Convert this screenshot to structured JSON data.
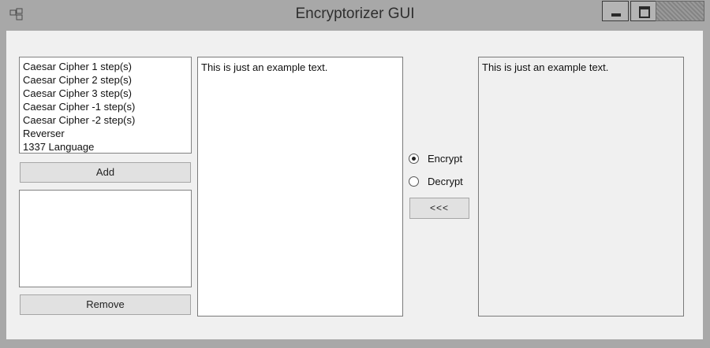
{
  "window": {
    "title": "Encryptorizer GUI",
    "icon": "application-icon",
    "controls": [
      "minimize-icon",
      "maximize-icon",
      "close-icon"
    ]
  },
  "algorithms": {
    "items": [
      "Caesar Cipher 1 step(s)",
      "Caesar Cipher 2 step(s)",
      "Caesar Cipher 3 step(s)",
      "Caesar Cipher -1 step(s)",
      "Caesar Cipher -2 step(s)",
      "Reverser",
      "1337 Language"
    ]
  },
  "buttons": {
    "add": "Add",
    "remove": "Remove",
    "transfer": "<<<"
  },
  "input": {
    "value": "This is just an example text."
  },
  "output": {
    "value": "This is just an example text."
  },
  "mode": {
    "encrypt_label": "Encrypt",
    "decrypt_label": "Decrypt",
    "selected": "Encrypt"
  }
}
